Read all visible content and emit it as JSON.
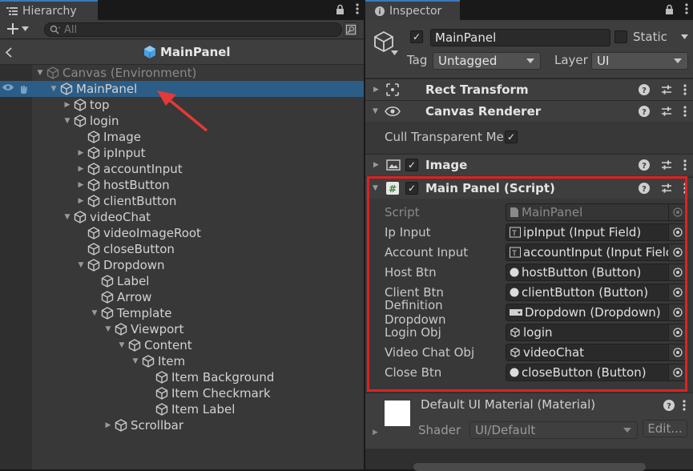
{
  "hierarchy": {
    "tab_title": "Hierarchy",
    "search_placeholder": "All",
    "prefab_title": "MainPanel",
    "scene_root": "Canvas (Environment)",
    "rows": [
      {
        "label": "MainPanel",
        "depth": 1,
        "arrow": "open",
        "selected": true
      },
      {
        "label": "top",
        "depth": 2,
        "arrow": "closed"
      },
      {
        "label": "login",
        "depth": 2,
        "arrow": "open"
      },
      {
        "label": "Image",
        "depth": 3,
        "arrow": "none"
      },
      {
        "label": "ipInput",
        "depth": 3,
        "arrow": "closed"
      },
      {
        "label": "accountInput",
        "depth": 3,
        "arrow": "closed"
      },
      {
        "label": "hostButton",
        "depth": 3,
        "arrow": "closed"
      },
      {
        "label": "clientButton",
        "depth": 3,
        "arrow": "closed"
      },
      {
        "label": "videoChat",
        "depth": 2,
        "arrow": "open"
      },
      {
        "label": "videoImageRoot",
        "depth": 3,
        "arrow": "none"
      },
      {
        "label": "closeButton",
        "depth": 3,
        "arrow": "none"
      },
      {
        "label": "Dropdown",
        "depth": 3,
        "arrow": "open"
      },
      {
        "label": "Label",
        "depth": 4,
        "arrow": "none"
      },
      {
        "label": "Arrow",
        "depth": 4,
        "arrow": "none"
      },
      {
        "label": "Template",
        "depth": 4,
        "arrow": "open"
      },
      {
        "label": "Viewport",
        "depth": 5,
        "arrow": "open"
      },
      {
        "label": "Content",
        "depth": 6,
        "arrow": "open"
      },
      {
        "label": "Item",
        "depth": 7,
        "arrow": "open"
      },
      {
        "label": "Item Background",
        "depth": 8,
        "arrow": "none"
      },
      {
        "label": "Item Checkmark",
        "depth": 8,
        "arrow": "none"
      },
      {
        "label": "Item Label",
        "depth": 8,
        "arrow": "none"
      },
      {
        "label": "Scrollbar",
        "depth": 5,
        "arrow": "closed"
      }
    ]
  },
  "inspector": {
    "tab_title": "Inspector",
    "object_name": "MainPanel",
    "static_label": "Static",
    "tag_label": "Tag",
    "tag_value": "Untagged",
    "layer_label": "Layer",
    "layer_value": "UI",
    "components": {
      "rect_transform": "Rect Transform",
      "canvas_renderer": "Canvas Renderer",
      "cull_label": "Cull Transparent Mes",
      "image": "Image",
      "script": "Main Panel (Script)"
    },
    "script_fields": [
      {
        "label": "Script",
        "value": "MainPanel",
        "icon": "script-file-icon",
        "disabled": true
      },
      {
        "label": "Ip Input",
        "value": "ipInput (Input Field)",
        "icon": "input-field-icon"
      },
      {
        "label": "Account Input",
        "value": "accountInput (Input Field)",
        "icon": "input-field-icon"
      },
      {
        "label": "Host Btn",
        "value": "hostButton (Button)",
        "icon": "button-icon"
      },
      {
        "label": "Client Btn",
        "value": "clientButton (Button)",
        "icon": "button-icon"
      },
      {
        "label": "Definition Dropdown",
        "value": "Dropdown (Dropdown)",
        "icon": "dropdown-icon"
      },
      {
        "label": "Login Obj",
        "value": "login",
        "icon": "gameobject-icon"
      },
      {
        "label": "Video Chat Obj",
        "value": "videoChat",
        "icon": "gameobject-icon"
      },
      {
        "label": "Close Btn",
        "value": "closeButton (Button)",
        "icon": "button-icon"
      }
    ],
    "material": {
      "title": "Default UI Material (Material)",
      "shader_label": "Shader",
      "shader_value": "UI/Default",
      "edit_label": "Edit..."
    }
  },
  "colors": {
    "selection": "#2c5d87",
    "highlight_border": "#e02020",
    "annotation_arrow": "#e53935"
  }
}
